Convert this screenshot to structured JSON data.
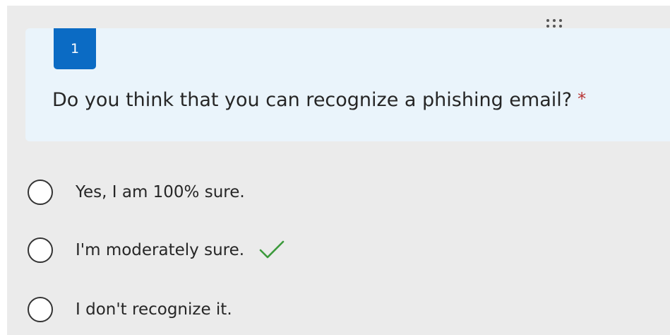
{
  "question": {
    "number": "1",
    "text": "Do you think that you can recognize a phishing email?",
    "required_marker": "*"
  },
  "options": [
    {
      "label": "Yes, I am 100% sure.",
      "selected": false,
      "marked_correct": false
    },
    {
      "label": "I'm moderately sure.",
      "selected": false,
      "marked_correct": true
    },
    {
      "label": "I don't recognize it.",
      "selected": false,
      "marked_correct": false
    }
  ],
  "icons": {
    "drag_handle": "drag-handle-icon",
    "correct_mark": "check-icon"
  },
  "colors": {
    "question_number_bg": "#0b6bc4",
    "question_card_bg": "#eaf4fb",
    "required_star": "#b83535",
    "check_mark": "#3c9a3c",
    "page_bg": "#ebebeb"
  }
}
